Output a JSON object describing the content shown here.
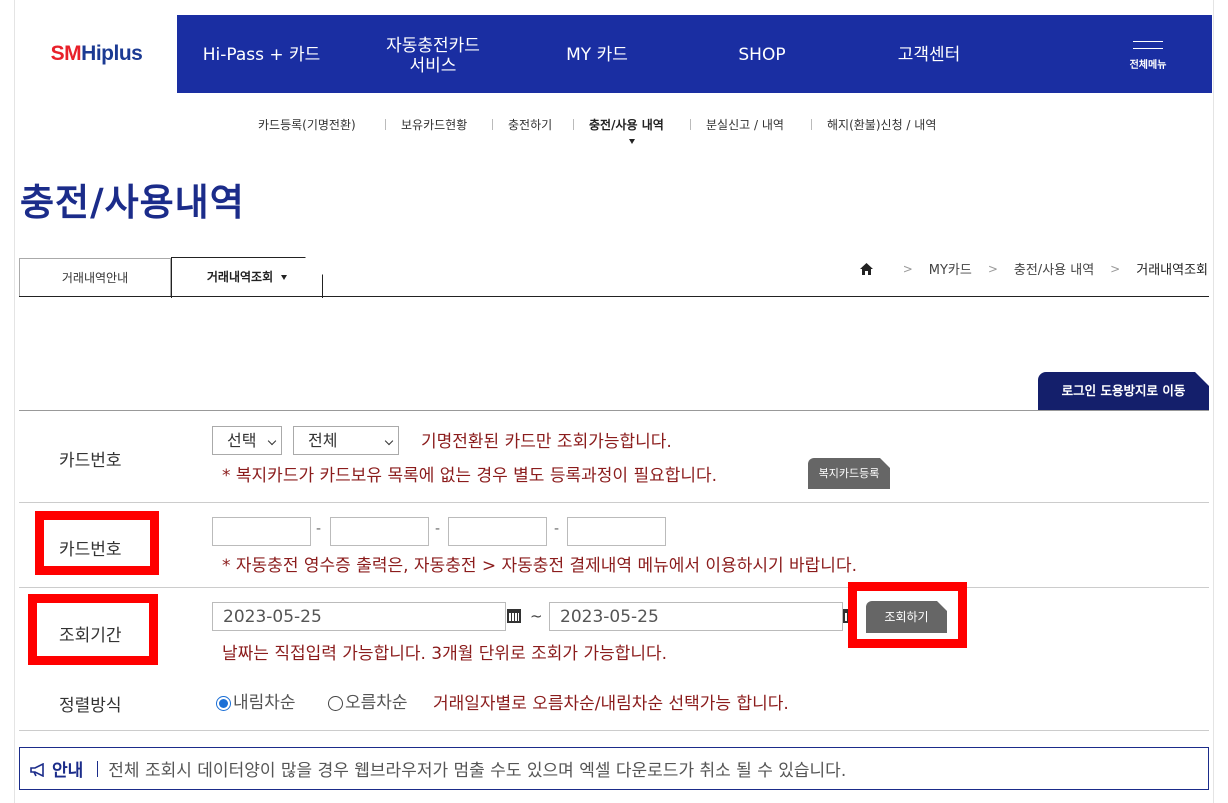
{
  "logo": {
    "sm": "SM",
    "hi": "Hiplus"
  },
  "gnb": {
    "items": [
      "Hi-Pass + 카드",
      "자동충전카드\n서비스",
      "MY 카드",
      "SHOP",
      "고객센터"
    ],
    "all_menu": "전체메뉴"
  },
  "subnav": [
    "카드등록(기명전환)",
    "보유카드현황",
    "충전하기",
    "충전/사용 내역",
    "분실신고 / 내역",
    "해지(환불)신청 / 내역"
  ],
  "page_title": "충전/사용내역",
  "tabs": [
    "거래내역안내",
    "거래내역조회"
  ],
  "breadcrumb": [
    "MY카드",
    "충전/사용 내역",
    "거래내역조회"
  ],
  "login_button": "로그인 도용방지로 이동",
  "form": {
    "card_label_1": "카드번호",
    "select_1": "선택",
    "select_2": "전체",
    "note_1": "기명전환된 카드만 조회가능합니다.",
    "note_2": "* 복지카드가 카드보유 목록에 없는 경우 별도 등록과정이 필요합니다.",
    "welfare_button": "복지카드등록",
    "card_label_2": "카드번호",
    "note_3": "* 자동충전 영수증 출력은, 자동충전 > 자동충전 결제내역 메뉴에서 이용하시기 바랍니다.",
    "period_label": "조회기간",
    "date_from": "2023-05-25",
    "tilde": "~",
    "date_to": "2023-05-25",
    "search_button": "조회하기",
    "note_4": "날짜는 직접입력 가능합니다. 3개월 단위로 조회가 가능합니다.",
    "sort_label": "정렬방식",
    "sort_desc": "내림차순",
    "sort_asc": "오름차순",
    "note_5": "거래일자별로 오름차순/내림차순 선택가능 합니다."
  },
  "notice": {
    "title": "안내",
    "message": "전체 조회시 데이터양이 많을 경우 웹브라우저가 멈출 수도 있으며 엑셀 다운로드가 취소 될 수 있습니다."
  }
}
